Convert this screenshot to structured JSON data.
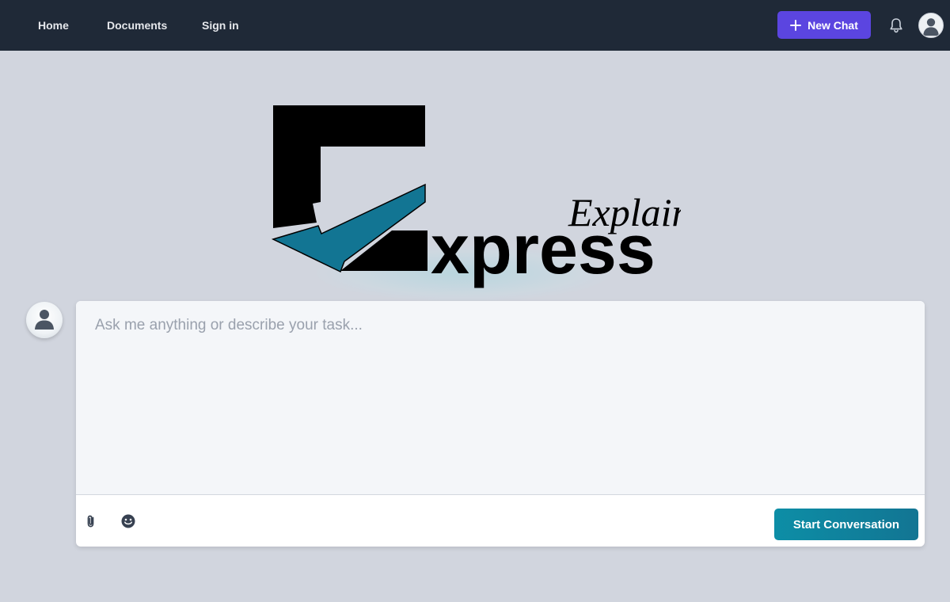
{
  "nav": {
    "links": [
      "Home",
      "Documents",
      "Sign in"
    ],
    "new_chat_label": "New Chat",
    "icons": [
      "plus-icon",
      "bell-icon",
      "user-avatar-icon"
    ]
  },
  "logo": {
    "brand_main": "xpress",
    "brand_script": "Explain",
    "colors": {
      "accent": "#127593",
      "ink": "#000000"
    }
  },
  "composer": {
    "placeholder": "Ask me anything or describe your task...",
    "value": "",
    "tools": [
      "paperclip-icon",
      "emoji-icon"
    ],
    "submit_label": "Start Conversation"
  },
  "colors": {
    "topbar": "#1f2937",
    "page_bg": "#d1d5de",
    "new_chat": "#5b45e0",
    "submit": "#0d8ea6"
  }
}
